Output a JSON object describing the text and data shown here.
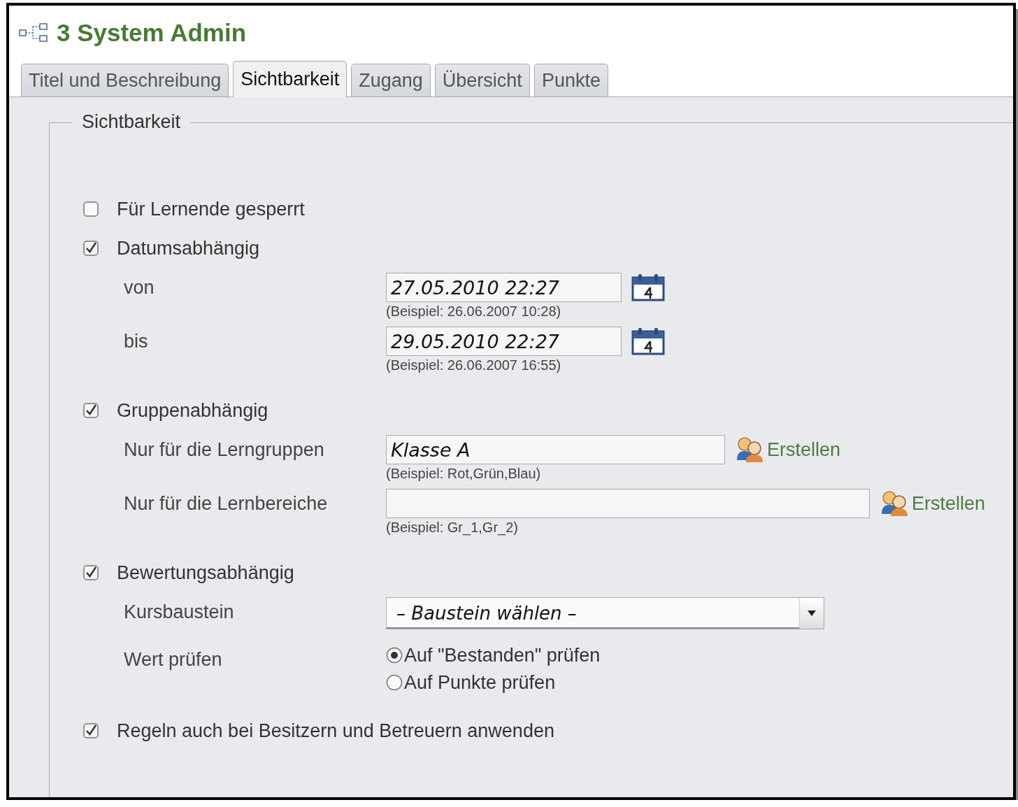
{
  "title": "3 System Admin",
  "tabs": [
    {
      "label": "Titel und Beschreibung",
      "selected": false
    },
    {
      "label": "Sichtbarkeit",
      "selected": true
    },
    {
      "label": "Zugang",
      "selected": false
    },
    {
      "label": "Übersicht",
      "selected": false
    },
    {
      "label": "Punkte",
      "selected": false
    }
  ],
  "fieldset": {
    "legend": "Sichtbarkeit",
    "sections": [
      {
        "label": "Für Lernende gesperrt",
        "checked": false
      },
      {
        "label": "Datumsabhängig",
        "checked": true,
        "fields": [
          {
            "kind": "date",
            "label": "von",
            "value": "27.05.2010 22:27",
            "hint": "(Beispiel: 26.06.2007 10:28)"
          },
          {
            "kind": "date",
            "label": "bis",
            "value": "29.05.2010 22:27",
            "hint": "(Beispiel: 26.06.2007 16:55)"
          }
        ]
      },
      {
        "label": "Gruppenabhängig",
        "checked": true,
        "fields": [
          {
            "kind": "text",
            "label": "Nur für die Lerngruppen",
            "value": "Klasse A",
            "hint": "(Beispiel: Rot,Grün,Blau)",
            "action": "Erstellen"
          },
          {
            "kind": "text",
            "label": "Nur für die Lernbereiche",
            "hint": "(Beispiel: Gr_1,Gr_2)",
            "action": "Erstellen"
          }
        ]
      },
      {
        "label": "Bewertungsabhängig",
        "checked": true,
        "fields": [
          {
            "kind": "select",
            "label": "Kursbaustein",
            "value": "– Baustein wählen –"
          },
          {
            "kind": "radio",
            "label": "Wert prüfen",
            "options": [
              {
                "label": "Auf \"Bestanden\" prüfen",
                "selected": true
              },
              {
                "label": "Auf Punkte prüfen",
                "selected": false
              }
            ]
          }
        ]
      },
      {
        "label": "Regeln auch bei Besitzern und Betreuern anwenden",
        "checked": true
      }
    ]
  }
}
